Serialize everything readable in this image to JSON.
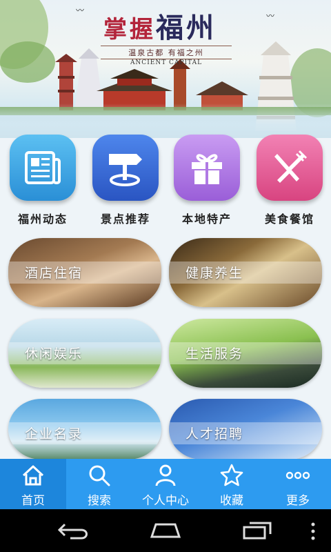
{
  "banner": {
    "title_part1": "掌握",
    "title_part2": "福州",
    "subtitle": "温泉古都 有福之州",
    "english": "ANCIENT CAPITAL"
  },
  "categories": [
    {
      "label": "福州动态",
      "icon": "newspaper-icon",
      "color": "#3aa6e6"
    },
    {
      "label": "景点推荐",
      "icon": "signpost-icon",
      "color": "#3b6fd8"
    },
    {
      "label": "本地特产",
      "icon": "gift-icon",
      "color": "#b57be8"
    },
    {
      "label": "美食餐馆",
      "icon": "fork-knife-icon",
      "color": "#e8609a"
    }
  ],
  "cards": [
    {
      "label": "酒店住宿"
    },
    {
      "label": "健康养生"
    },
    {
      "label": "休闲娱乐"
    },
    {
      "label": "生活服务"
    },
    {
      "label": "企业名录"
    },
    {
      "label": "人才招聘"
    }
  ],
  "tabs": [
    {
      "label": "首页",
      "icon": "home-icon",
      "active": true
    },
    {
      "label": "搜索",
      "icon": "search-icon"
    },
    {
      "label": "个人中心",
      "icon": "person-icon"
    },
    {
      "label": "收藏",
      "icon": "star-icon"
    },
    {
      "label": "更多",
      "icon": "more-dots-icon"
    }
  ],
  "colors": {
    "tabbar": "#2d9bf0",
    "tab_active": "#1d86dc"
  }
}
